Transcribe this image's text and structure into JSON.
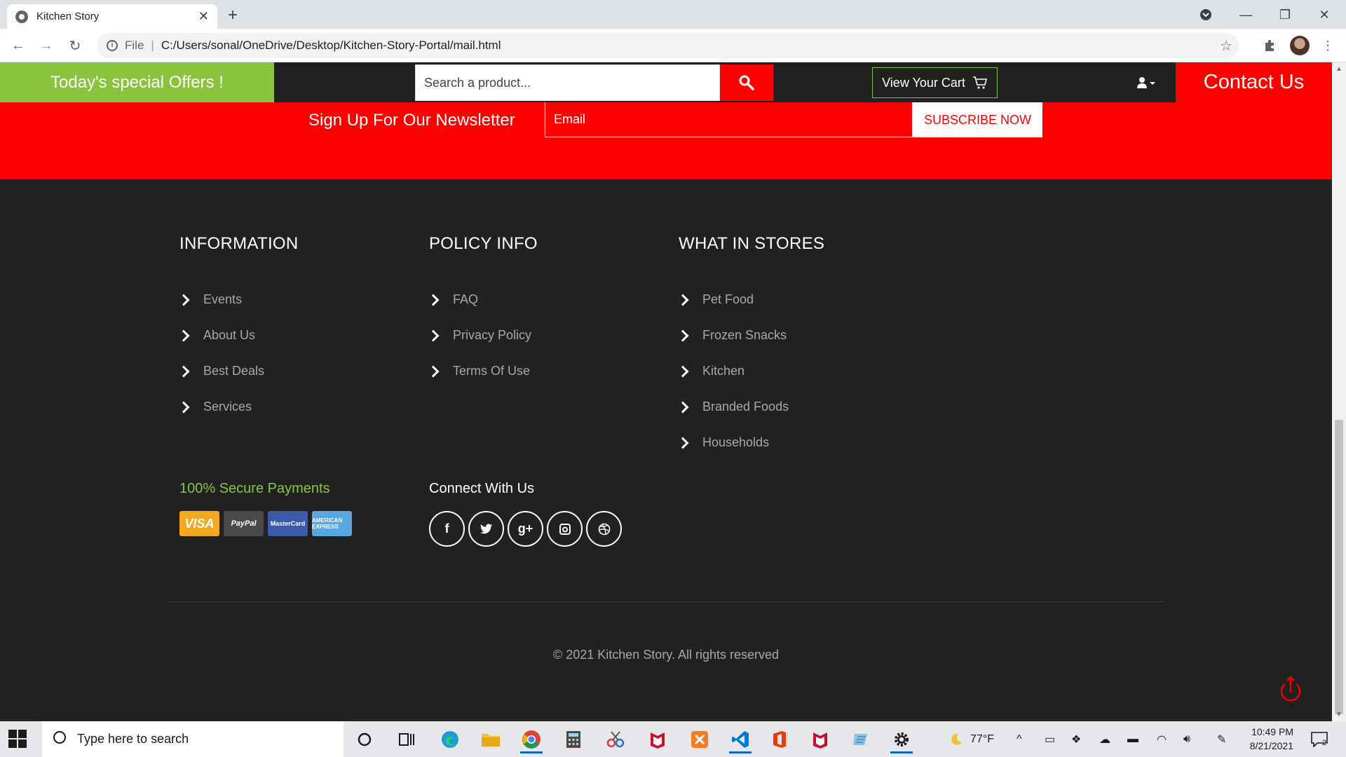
{
  "browser": {
    "tab_title": "Kitchen Story",
    "new_tab_symbol": "+",
    "url_protocol": "File",
    "url": "C:/Users/sonal/OneDrive/Desktop/Kitchen-Story-Portal/mail.html"
  },
  "header": {
    "offers_label": "Today's special Offers !",
    "search_placeholder": "Search a product...",
    "cart_label": "View Your Cart",
    "contact_label": "Contact Us"
  },
  "newsletter": {
    "title": "Sign Up For Our Newsletter",
    "email_placeholder": "Email",
    "subscribe_label": "SUBSCRIBE NOW"
  },
  "footer": {
    "information": {
      "heading": "INFORMATION",
      "items": [
        "Events",
        "About Us",
        "Best Deals",
        "Services"
      ]
    },
    "policy": {
      "heading": "POLICY INFO",
      "items": [
        "FAQ",
        "Privacy Policy",
        "Terms Of Use"
      ]
    },
    "stores": {
      "heading": "WHAT IN STORES",
      "items": [
        "Pet Food",
        "Frozen Snacks",
        "Kitchen",
        "Branded Foods",
        "Households"
      ]
    },
    "secure_payments": "100% Secure Payments",
    "payment_cards": [
      "VISA",
      "PayPal",
      "MasterCard",
      "AMERICAN EXPRESS"
    ],
    "connect_heading": "Connect With Us",
    "social": [
      {
        "name": "facebook",
        "glyph": "f"
      },
      {
        "name": "twitter",
        "glyph": "t"
      },
      {
        "name": "google-plus",
        "glyph": "g+"
      },
      {
        "name": "instagram",
        "glyph": "◘"
      },
      {
        "name": "dribbble",
        "glyph": "⊛"
      }
    ],
    "copyright": "© 2021 Kitchen Story. All rights reserved"
  },
  "taskbar": {
    "search_placeholder": "Type here to search",
    "weather": "77°F",
    "time": "10:49 PM",
    "date": "8/21/2021",
    "notification_count": "2"
  },
  "colors": {
    "accent_green": "#8ac43f",
    "accent_red": "#ff0000",
    "footer_bg": "#212121"
  }
}
